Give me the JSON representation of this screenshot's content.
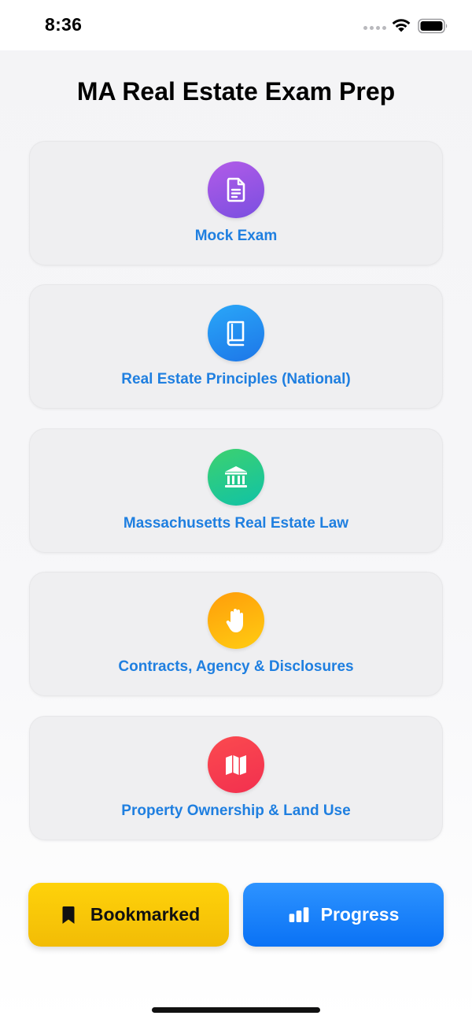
{
  "status_bar": {
    "time": "8:36"
  },
  "header": {
    "title": "MA Real Estate Exam Prep"
  },
  "categories": [
    {
      "label": "Mock Exam",
      "icon": "document-icon",
      "color": "#9b59e6"
    },
    {
      "label": "Real Estate Principles (National)",
      "icon": "book-icon",
      "color": "#1f8ef0"
    },
    {
      "label": "Massachusetts Real Estate Law",
      "icon": "building-columns-icon",
      "color": "#22c98a"
    },
    {
      "label": "Contracts, Agency & Disclosures",
      "icon": "hand-icon",
      "color": "#ffb30f"
    },
    {
      "label": "Property Ownership & Land Use",
      "icon": "map-icon",
      "color": "#f53d4f"
    }
  ],
  "bottom_bar": {
    "bookmarked_label": "Bookmarked",
    "progress_label": "Progress"
  },
  "colors": {
    "accent_text": "#1f7fe0",
    "bookmarked": "#ffcc0a",
    "progress": "#1a82fa"
  }
}
